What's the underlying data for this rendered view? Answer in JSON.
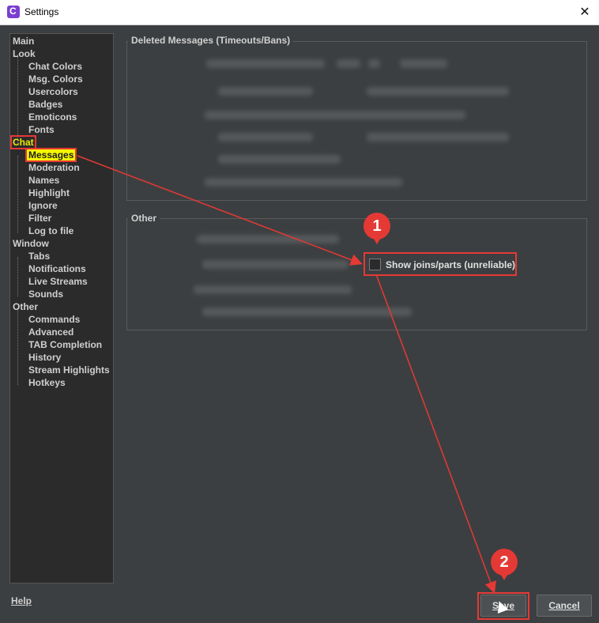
{
  "window": {
    "title": "Settings",
    "icon": "chatty-icon",
    "close_glyph": "✕"
  },
  "sidebar": {
    "items": [
      {
        "label": "Main",
        "level": 0
      },
      {
        "label": "Look",
        "level": 0
      },
      {
        "label": "Chat Colors",
        "level": 1
      },
      {
        "label": "Msg. Colors",
        "level": 1
      },
      {
        "label": "Usercolors",
        "level": 1
      },
      {
        "label": "Badges",
        "level": 1
      },
      {
        "label": "Emoticons",
        "level": 1
      },
      {
        "label": "Fonts",
        "level": 1
      },
      {
        "label": "Chat",
        "level": 0
      },
      {
        "label": "Messages",
        "level": 1
      },
      {
        "label": "Moderation",
        "level": 1
      },
      {
        "label": "Names",
        "level": 1
      },
      {
        "label": "Highlight",
        "level": 1
      },
      {
        "label": "Ignore",
        "level": 1
      },
      {
        "label": "Filter",
        "level": 1
      },
      {
        "label": "Log to file",
        "level": 1
      },
      {
        "label": "Window",
        "level": 0
      },
      {
        "label": "Tabs",
        "level": 1
      },
      {
        "label": "Notifications",
        "level": 1
      },
      {
        "label": "Live Streams",
        "level": 1
      },
      {
        "label": "Sounds",
        "level": 1
      },
      {
        "label": "Other",
        "level": 0
      },
      {
        "label": "Commands",
        "level": 1
      },
      {
        "label": "Advanced",
        "level": 1
      },
      {
        "label": "TAB Completion",
        "level": 1
      },
      {
        "label": "History",
        "level": 1
      },
      {
        "label": "Stream Highlights",
        "level": 1
      },
      {
        "label": "Hotkeys",
        "level": 1
      }
    ]
  },
  "groups": {
    "deleted": {
      "title": "Deleted Messages (Timeouts/Bans)"
    },
    "other": {
      "title": "Other",
      "joins_label": "Show joins/parts (unreliable)",
      "joins_checked": false
    }
  },
  "footer": {
    "help": "Help",
    "save": "Save",
    "cancel": "Cancel"
  },
  "markers": {
    "one": "1",
    "two": "2"
  },
  "colors": {
    "accent": "#e53935",
    "highlight": "#f6f600",
    "background": "#3c3f41"
  }
}
